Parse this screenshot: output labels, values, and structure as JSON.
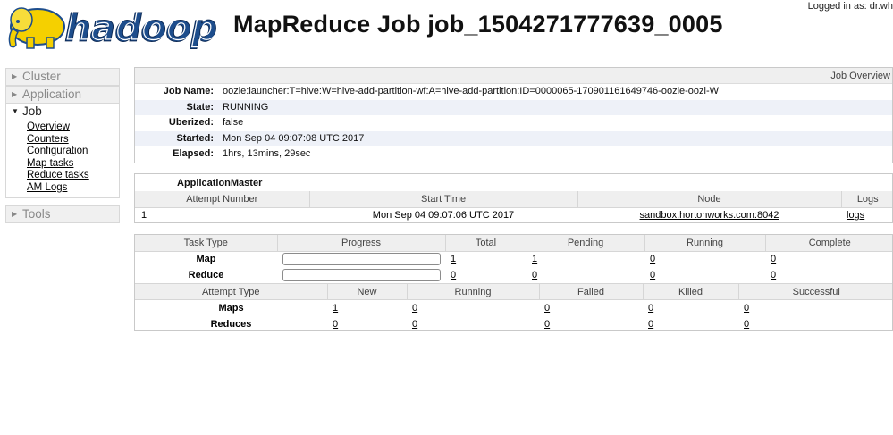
{
  "header": {
    "logo_text": "hadoop",
    "title": "MapReduce Job job_1504271777639_0005",
    "logged_in": "Logged in as: dr.wh"
  },
  "sidebar": {
    "cluster": "Cluster",
    "application": "Application",
    "job": "Job",
    "job_links": [
      "Overview",
      "Counters",
      "Configuration",
      "Map tasks",
      "Reduce tasks",
      "AM Logs"
    ],
    "tools": "Tools"
  },
  "overview": {
    "header": "Job Overview",
    "job_name_label": "Job Name:",
    "job_name": "oozie:launcher:T=hive:W=hive-add-partition-wf:A=hive-add-partition:ID=0000065-170901161649746-oozie-oozi-W",
    "state_label": "State:",
    "state": "RUNNING",
    "uberized_label": "Uberized:",
    "uberized": "false",
    "started_label": "Started:",
    "started": "Mon Sep 04 09:07:08 UTC 2017",
    "elapsed_label": "Elapsed:",
    "elapsed": "1hrs, 13mins, 29sec"
  },
  "am": {
    "title": "ApplicationMaster",
    "columns": [
      "Attempt Number",
      "Start Time",
      "Node",
      "Logs"
    ],
    "row": {
      "attempt": "1",
      "start_time": "Mon Sep 04 09:07:06 UTC 2017",
      "node": "sandbox.hortonworks.com:8042",
      "logs": "logs"
    }
  },
  "tasks": {
    "columns": [
      "Task Type",
      "Progress",
      "Total",
      "Pending",
      "Running",
      "Complete"
    ],
    "map": {
      "label": "Map",
      "progress": 0,
      "total": "1",
      "pending": "1",
      "running": "0",
      "complete": "0"
    },
    "reduce": {
      "label": "Reduce",
      "progress": 0,
      "total": "0",
      "pending": "0",
      "running": "0",
      "complete": "0"
    }
  },
  "attempts": {
    "columns": [
      "Attempt Type",
      "New",
      "Running",
      "Failed",
      "Killed",
      "Successful"
    ],
    "maps": {
      "label": "Maps",
      "new": "1",
      "running": "0",
      "failed": "0",
      "killed": "0",
      "successful": "0"
    },
    "reduces": {
      "label": "Reduces",
      "new": "0",
      "running": "0",
      "failed": "0",
      "killed": "0",
      "successful": "0"
    }
  },
  "colors": {
    "progress_fill": "#3b8d3b",
    "logo_yellow": "#f5d000",
    "logo_blue": "#1d4d8c"
  }
}
